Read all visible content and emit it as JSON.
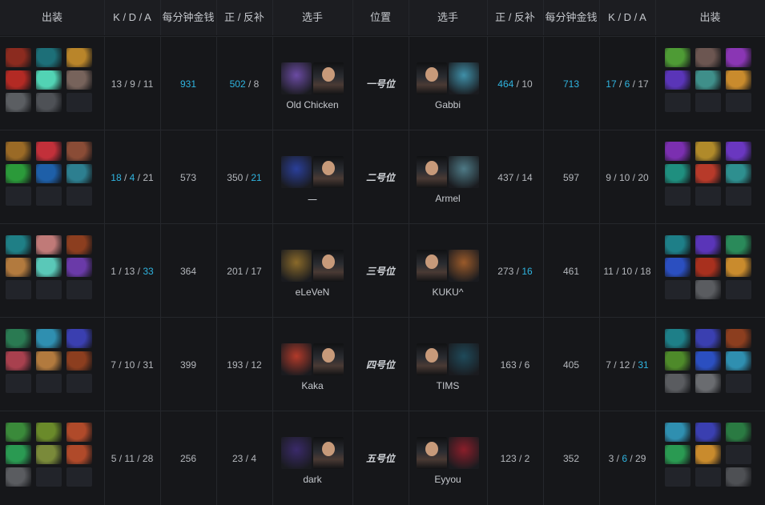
{
  "header": {
    "items": "出装",
    "kda": "K / D / A",
    "gpm": "每分钟金钱",
    "lhdn": "正 / 反补",
    "player": "选手",
    "position": "位置"
  },
  "colors": {
    "highlight": "#2fb4e0"
  },
  "rows": [
    {
      "position": "一号位",
      "left": {
        "name": "Old Chicken",
        "kda": [
          "13",
          "9",
          "11"
        ],
        "kda_hl": [
          false,
          false,
          false
        ],
        "gpm": "931",
        "gpm_hl": true,
        "lh": "502",
        "lh_hl": true,
        "dn": "8",
        "dn_hl": false,
        "items": [
          "#8b2b1f",
          "#1d6f78",
          "#b9852a",
          "#b32a24",
          "#52d3b4",
          "#77635b",
          "#5b5e62",
          "#4e5156",
          "empty"
        ],
        "hero_color": "#6b4ba3"
      },
      "right": {
        "name": "Gabbi",
        "kda": [
          "17",
          "6",
          "17"
        ],
        "kda_hl": [
          true,
          true,
          false
        ],
        "gpm": "713",
        "gpm_hl": true,
        "lh": "464",
        "lh_hl": true,
        "dn": "10",
        "dn_hl": false,
        "items": [
          "#4e9b35",
          "#6c5651",
          "#8a36b4",
          "#5a35b8",
          "#3f8f8a",
          "#c98b2d",
          "empty",
          "empty",
          "empty"
        ],
        "hero_color": "#3f8fa8"
      }
    },
    {
      "position": "二号位",
      "left": {
        "name": "一",
        "kda": [
          "18",
          "4",
          "21"
        ],
        "kda_hl": [
          true,
          true,
          false
        ],
        "gpm": "573",
        "gpm_hl": false,
        "lh": "350",
        "lh_hl": false,
        "dn": "21",
        "dn_hl": true,
        "items": [
          "#9a6a26",
          "#c2303a",
          "#8a4c36",
          "#2b9a3a",
          "#1e5fa8",
          "#2d7f90",
          "empty",
          "empty",
          "empty"
        ],
        "hero_color": "#2a3f9a"
      },
      "right": {
        "name": "Armel",
        "kda": [
          "9",
          "10",
          "20"
        ],
        "kda_hl": [
          false,
          false,
          false
        ],
        "gpm": "597",
        "gpm_hl": false,
        "lh": "437",
        "lh_hl": false,
        "dn": "14",
        "dn_hl": false,
        "items": [
          "#7b2fb0",
          "#b08a2a",
          "#6a37c0",
          "#1f8f7f",
          "#b73a2a",
          "#2e8f8f",
          "empty",
          "empty",
          "empty"
        ],
        "hero_color": "#4e7a86"
      }
    },
    {
      "position": "三号位",
      "left": {
        "name": "eLeVeN",
        "kda": [
          "1",
          "13",
          "33"
        ],
        "kda_hl": [
          false,
          false,
          true
        ],
        "gpm": "364",
        "gpm_hl": false,
        "lh": "201",
        "lh_hl": false,
        "dn": "17",
        "dn_hl": false,
        "items": [
          "#1f7f86",
          "#c07a78",
          "#8c3e1f",
          "#b27a3e",
          "#5ac8b8",
          "#6a3aa8",
          "empty",
          "empty",
          "empty"
        ],
        "hero_color": "#8a6a2a"
      },
      "right": {
        "name": "KUKU^",
        "kda": [
          "11",
          "10",
          "18"
        ],
        "kda_hl": [
          false,
          false,
          false
        ],
        "gpm": "461",
        "gpm_hl": false,
        "lh": "273",
        "lh_hl": false,
        "dn": "16",
        "dn_hl": true,
        "items": [
          "#1e7f88",
          "#5a35b8",
          "#2a8a5a",
          "#2b4fc0",
          "#a8301e",
          "#c98b2d",
          "empty",
          "#5a5c60",
          "empty"
        ],
        "hero_color": "#9a5a2a"
      }
    },
    {
      "position": "四号位",
      "left": {
        "name": "Kaka",
        "kda": [
          "7",
          "10",
          "31"
        ],
        "kda_hl": [
          false,
          false,
          false
        ],
        "gpm": "399",
        "gpm_hl": false,
        "lh": "193",
        "lh_hl": false,
        "dn": "12",
        "dn_hl": false,
        "items": [
          "#2a7a52",
          "#2f8fb0",
          "#3a3fb0",
          "#a8404e",
          "#b27a3e",
          "#8c3e1f",
          "empty",
          "empty",
          "empty"
        ],
        "hero_color": "#b23a2a"
      },
      "right": {
        "name": "TIMS",
        "kda": [
          "7",
          "12",
          "31"
        ],
        "kda_hl": [
          false,
          false,
          true
        ],
        "gpm": "405",
        "gpm_hl": false,
        "lh": "163",
        "lh_hl": false,
        "dn": "6",
        "dn_hl": false,
        "items": [
          "#1e7f88",
          "#3a3fb0",
          "#8c3e1f",
          "#4e8a2a",
          "#2b4fc0",
          "#2f8fb0",
          "#5a5c60",
          "#6a6c70",
          "empty"
        ],
        "hero_color": "#1f4a5a"
      }
    },
    {
      "position": "五号位",
      "left": {
        "name": "dark",
        "kda": [
          "5",
          "11",
          "28"
        ],
        "kda_hl": [
          false,
          false,
          false
        ],
        "gpm": "256",
        "gpm_hl": false,
        "lh": "23",
        "lh_hl": false,
        "dn": "4",
        "dn_hl": false,
        "items": [
          "#3a8a3a",
          "#6a8a2a",
          "#b04a2a",
          "#2a9a52",
          "#7a8a3a",
          "#b04a2a",
          "#5a5c60",
          "empty",
          "empty"
        ],
        "hero_color": "#3a2a6a"
      },
      "right": {
        "name": "Eyyou",
        "kda": [
          "3",
          "6",
          "29"
        ],
        "kda_hl": [
          false,
          true,
          false
        ],
        "gpm": "352",
        "gpm_hl": false,
        "lh": "123",
        "lh_hl": false,
        "dn": "2",
        "dn_hl": false,
        "items": [
          "#2f8fb0",
          "#3a3fb0",
          "#2a7a42",
          "#2a9a52",
          "#c98b2d",
          "empty",
          "empty",
          "empty",
          "#4e5054"
        ],
        "hero_color": "#8a1e2a"
      }
    }
  ]
}
